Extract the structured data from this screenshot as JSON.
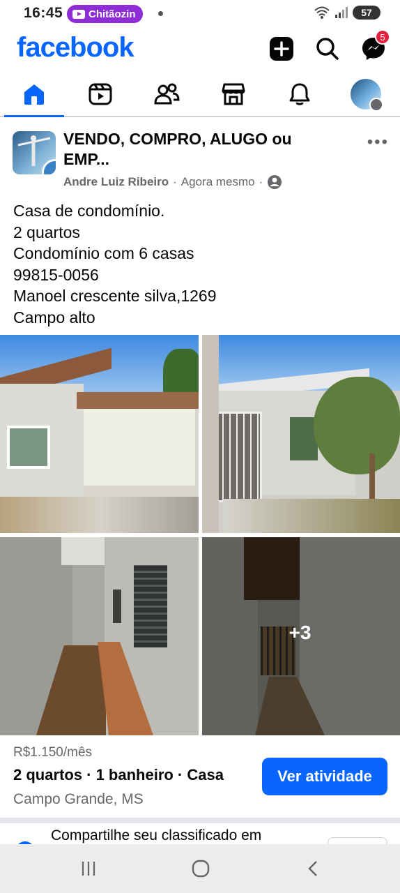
{
  "status_bar": {
    "time": "16:45",
    "notification_app": "Chitãozin",
    "battery": "57"
  },
  "header": {
    "logo": "facebook",
    "messenger_badge": "5"
  },
  "nav_tabs": [
    {
      "name": "home-icon"
    },
    {
      "name": "video-icon"
    },
    {
      "name": "friends-icon"
    },
    {
      "name": "marketplace-icon"
    },
    {
      "name": "notifications-icon"
    },
    {
      "name": "profile-avatar"
    }
  ],
  "post": {
    "group_name": "VENDO, COMPRO, ALUGO ou EMP...",
    "author": "Andre Luiz Ribeiro",
    "time": "Agora mesmo",
    "text_lines": [
      "Casa de condomínio.",
      "2 quartos",
      "Condomínio com 6 casas",
      "99815-0056",
      "Manoel crescente silva,1269",
      "Campo alto"
    ],
    "more_photos": "+3"
  },
  "listing": {
    "price": "R$1.150/mês",
    "summary": "2 quartos · 1 banheiro · Casa",
    "location": "Campo Grande, MS",
    "button_label": "Ver atividade"
  },
  "share": {
    "text": "Compartilhe seu classificado em"
  },
  "colors": {
    "brand_blue": "#0866ff",
    "secondary_text": "#65676b",
    "badge_red": "#e41e3f"
  }
}
